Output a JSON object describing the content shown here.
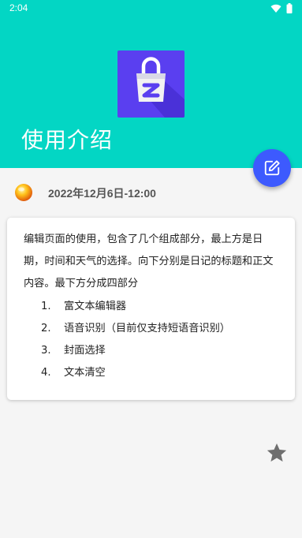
{
  "status_bar": {
    "time": "2:04"
  },
  "header": {
    "title": "使用介绍"
  },
  "entry": {
    "date": "2022年12月6日-12:00",
    "weather_icon": "sun-weather-icon"
  },
  "content": {
    "intro": "编辑页面的使用，包含了几个组成部分，最上方是日期，时间和天气的选择。向下分别是日记的标题和正文内容。最下方分成四部分",
    "items": [
      {
        "num": "1.",
        "text": "富文本编辑器"
      },
      {
        "num": "2.",
        "text": "语音识别（目前仅支持短语音识别）"
      },
      {
        "num": "3.",
        "text": "封面选择"
      },
      {
        "num": "4.",
        "text": "文本清空"
      }
    ]
  },
  "colors": {
    "header_bg": "#03d6c4",
    "fab_bg": "#3d5afe",
    "app_icon_bg": "#5a3ff0"
  },
  "icons": {
    "fab": "edit-icon",
    "favorite": "star-icon",
    "wifi": "wifi-icon",
    "battery": "battery-icon"
  }
}
